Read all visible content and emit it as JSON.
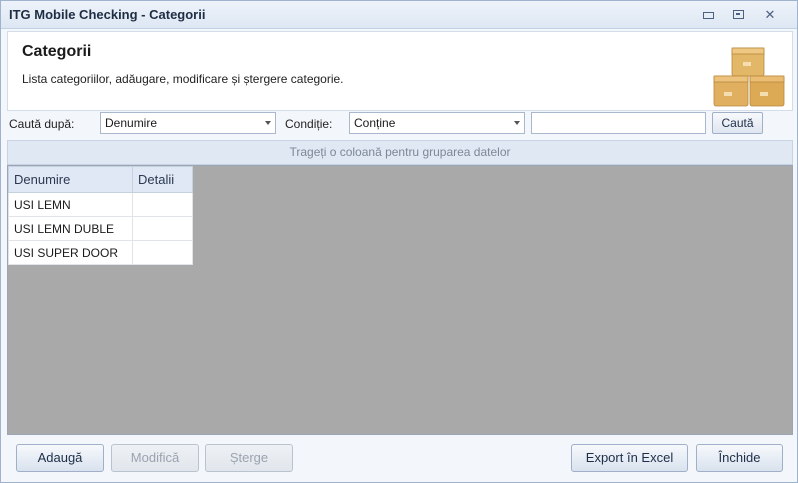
{
  "window": {
    "title": "ITG Mobile Checking - Categorii"
  },
  "header": {
    "title": "Categorii",
    "description": "Lista categoriilor, adăugare, modificare și ștergere categorie.",
    "icon": "boxes-icon"
  },
  "search": {
    "search_by_label": "Caută după:",
    "search_by_value": "Denumire",
    "condition_label": "Condiție:",
    "condition_value": "Conține",
    "text_value": "",
    "search_button": "Caută"
  },
  "group_bar": {
    "text": "Trageți o coloană pentru gruparea datelor"
  },
  "grid": {
    "columns": [
      "Denumire",
      "Detalii"
    ],
    "rows": [
      {
        "denumire": "USI LEMN",
        "detalii": ""
      },
      {
        "denumire": "USI LEMN DUBLE",
        "detalii": ""
      },
      {
        "denumire": "USI SUPER DOOR",
        "detalii": ""
      }
    ],
    "background_color": "#a9a9a9"
  },
  "footer": {
    "add": "Adaugă",
    "modify": "Modifică",
    "delete": "Șterge",
    "export": "Export în Excel",
    "close": "Închide"
  },
  "colors": {
    "accent": "#dfe8f4",
    "border": "#9fb0c8"
  }
}
